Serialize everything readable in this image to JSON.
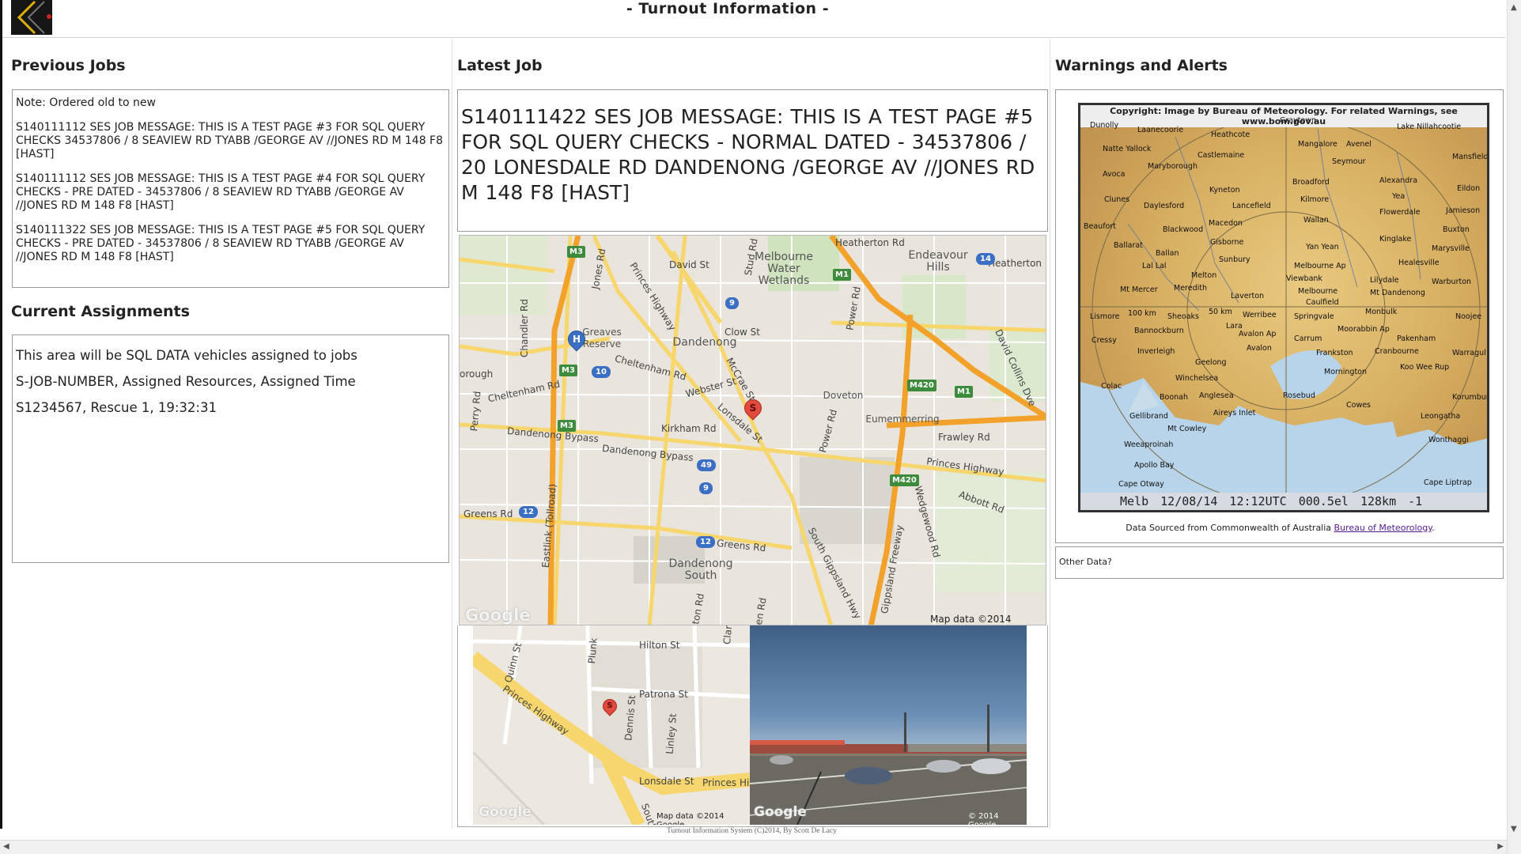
{
  "header": {
    "title": "- Turnout Information -"
  },
  "left": {
    "previous_jobs_title": "Previous Jobs",
    "previous_jobs": [
      "Note: Ordered old to new",
      "S140111112 SES JOB MESSAGE: THIS IS A TEST PAGE #3 FOR SQL QUERY CHECKS 34537806 / 8 SEAVIEW RD TYABB /GEORGE AV //JONES RD M 148 F8 [HAST]",
      "S140111112 SES JOB MESSAGE: THIS IS A TEST PAGE #4 FOR SQL QUERY CHECKS - PRE DATED - 34537806 / 8 SEAVIEW RD TYABB /GEORGE AV //JONES RD M 148 F8 [HAST]",
      "S140111322 SES JOB MESSAGE: THIS IS A TEST PAGE #5 FOR SQL QUERY CHECKS - PRE DATED - 34537806 / 8 SEAVIEW RD TYABB /GEORGE AV //JONES RD M 148 F8 [HAST]"
    ],
    "current_assignments_title": "Current Assignments",
    "assignments": [
      "This area will be SQL DATA vehicles assigned to jobs",
      "S-JOB-NUMBER, Assigned Resources, Assigned Time",
      "S1234567, Rescue 1, 19:32:31"
    ]
  },
  "middle": {
    "latest_job_title": "Latest Job",
    "latest_job_text": "S140111422 SES JOB MESSAGE: THIS IS A TEST PAGE #5 FOR SQL QUERY CHECKS - NORMAL DATED - 34537806 / 20 LONESDALE RD DANDENONG /GEORGE AV //JONES RD M 148 F8 [HAST]",
    "map": {
      "labels": {
        "melbourne_water_wetlands": "Melbourne Water Wetlands",
        "endeavour_hills": "Endeavour Hills",
        "dandenong": "Dandenong",
        "greaves_reserve": "Greaves Reserve",
        "doveton": "Doveton",
        "eumemmerring": "Eumemmerring",
        "dandenong_south": "Dandenong South",
        "heatherton_rd": "Heatherton Rd",
        "heatherton": "Heatherton",
        "david_st": "David St",
        "stud_rd": "Stud Rd",
        "princes_highway": "Princes Highway",
        "clow_st": "Clow St",
        "power_rd": "Power Rd",
        "chandler_rd": "Chandler Rd",
        "jones_rd": "Jones Rd",
        "cheltenham_rd": "Cheltenham Rd",
        "cheltenham_rd2": "Cheltenham Rd",
        "webster_st": "Webster St",
        "mccrae_st": "McCrae St",
        "lonsdale_st": "Lonsdale St",
        "kirkham_rd": "Kirkham Rd",
        "dandenong_bypass": "Dandenong Bypass",
        "dandenong_bypass2": "Dandenong Bypass",
        "frawley_rd": "Frawley Rd",
        "princes_highway2": "Princes Highway",
        "abbott_rd": "Abbott Rd",
        "wedgewood_rd": "Wedgewood Rd",
        "greens_rd": "Greens Rd",
        "greens_rd2": "Greens Rd",
        "eastlink": "Eastlink (Tollroad)",
        "south_gippsland_hwy": "South Gippsland Hwy",
        "gippsland_fwy": "Gippsland Freeway",
        "perry_rd": "Perry Rd",
        "borough": "orough",
        "david_collins_dr": "David Collins Dve",
        "stackston_rd": "xkston Rd",
        "chen_rd": "chen Rd",
        "power_rd2": "Power Rd"
      },
      "shields": {
        "m3a": "M3",
        "m3b": "M3",
        "m3c": "M3",
        "m1a": "M1",
        "m1b": "M1",
        "m420a": "M420",
        "m420b": "M420",
        "r9a": "9",
        "r9b": "9",
        "r10": "10",
        "r49": "49",
        "r12a": "12",
        "r12b": "12",
        "r14": "14"
      },
      "marker": "S",
      "hospital": "H",
      "google": "Google",
      "map_data": "Map data ©2014 Google"
    },
    "zoom_map": {
      "labels": {
        "hilton_st": "Hilton St",
        "patrona_st": "Patrona St",
        "dennis_st": "Dennis St",
        "linley_st": "Linley St",
        "lonsdale_st": "Lonsdale St",
        "princes_hi": "Princes Hi",
        "princes_highway": "Princes Highway",
        "quinn_st": "Quinn St",
        "plunk": "Plunk",
        "clar": "Clar",
        "south": "South"
      },
      "marker": "S",
      "google": "Google",
      "map_data": "Map data ©2014 Google"
    },
    "street_view": {
      "google": "Google",
      "copyright": "© 2014 Google"
    },
    "footer": "Turnout Information System (C)2014, By Scott De Lacy"
  },
  "right": {
    "warnings_title": "Warnings and Alerts",
    "radar_copyright": "Copyright: Image by Bureau of Meteorology. For related Warnings, see www.bom.gov.au",
    "radar_stamp": "Melb  12/08/14 12:12UTC 000.5el 128km -1",
    "radar_towns": {
      "graytown": "Graytown",
      "dunolly": "Dunolly",
      "laanecoorie": "Laanecoorie",
      "heathcote": "Heathcote",
      "lake_nillahcootie": "Lake Nillahcootie",
      "mangalore": "Mangalore",
      "avenel": "Avenel",
      "natte_yallock": "Natte Yallock",
      "maryborough": "Maryborough",
      "castlemaine": "Castlemaine",
      "seymour": "Seymour",
      "mansfield": "Mansfield",
      "avoca": "Avoca",
      "kyneton": "Kyneton",
      "broadford": "Broadford",
      "alexandra": "Alexandra",
      "clunes": "Clunes",
      "daylesford": "Daylesford",
      "lancefield": "Lancefield",
      "kilmore": "Kilmore",
      "yea": "Yea",
      "eildon": "Eildon",
      "beaufort": "Beaufort",
      "macedon": "Macedon",
      "wallan": "Wallan",
      "flowerdale": "Flowerdale",
      "jamieson": "Jamieson",
      "blackwood": "Blackwood",
      "buxton": "Buxton",
      "ballarat": "Ballarat",
      "gisborne": "Gisborne",
      "kinglake": "Kinglake",
      "ballan": "Ballan",
      "yan_yean": "Yan Yean",
      "marysville": "Marysville",
      "sunbury": "Sunbury",
      "lal_lal": "Lal Lal",
      "melbourne_ap": "Melbourne Ap",
      "healesville": "Healesville",
      "viewbank": "Viewbank",
      "lilydale": "Lilydale",
      "warburton": "Warburton",
      "melton": "Melton",
      "mt_mercer": "Mt Mercer",
      "meredith": "Meredith",
      "melbourne": "Melbourne",
      "mt_dandenong": "Mt Dandenong",
      "laverton": "Laverton",
      "caulfield": "Caulfield",
      "lismore": "Lismore",
      "sheoaks": "Sheoaks",
      "werribee": "Werribee",
      "springvale": "Springvale",
      "monbulk": "Monbulk",
      "noojee": "Noojee",
      "cressy": "Cressy",
      "bannockburn": "Bannockburn",
      "lara": "Lara",
      "avalon_ap": "Avalon Ap",
      "carrum": "Carrum",
      "moorabbin_ap": "Moorabbin Ap",
      "pakenham": "Pakenham",
      "inverleigh": "Inverleigh",
      "avalon": "Avalon",
      "frankston": "Frankston",
      "cranbourne": "Cranbourne",
      "warragul": "Warragul",
      "geelong": "Geelong",
      "mornington": "Mornington",
      "koo_wee_rup": "Koo Wee Rup",
      "colac": "Colac",
      "winchelsea": "Winchelsea",
      "boonah": "Boonah",
      "anglesea": "Anglesea",
      "rosebud": "Rosebud",
      "korumburra": "Korumburra",
      "gellibrand": "Gellibrand",
      "aireys_inlet": "Aireys Inlet",
      "cowes": "Cowes",
      "leongatha": "Leongatha",
      "mt_cowley": "Mt Cowley",
      "wonthaggi": "Wonthaggi",
      "weeaproinah": "Weeaproinah",
      "apollo_bay": "Apollo Bay",
      "cape_otway": "Cape Otway",
      "cape_liptrap": "Cape Liptrap",
      "km100": "100 km",
      "km50": "50 km"
    },
    "radar_source_text": "Data Sourced from Commonwealth of Australia ",
    "radar_source_link": "Bureau of Meteorology",
    "radar_source_end": ".",
    "other_data": "Other Data?"
  },
  "scrollbars": {
    "left": "◀",
    "right": "▶",
    "up": "▲",
    "down": "▼"
  }
}
